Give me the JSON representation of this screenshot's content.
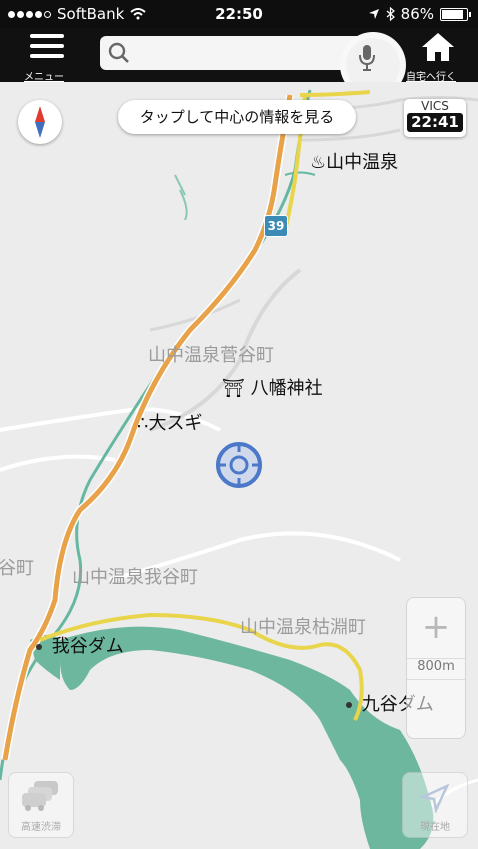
{
  "status_bar": {
    "carrier": "SoftBank",
    "time": "22:50",
    "battery": "86%",
    "battery_level": 0.86
  },
  "top_bar": {
    "menu_label": "メニュー",
    "search_placeholder": "",
    "home_label": "自宅へ行く"
  },
  "map_controls": {
    "center_tip": "タップして中心の情報を見る",
    "vics_name": "VICS",
    "vics_time": "22:41",
    "scale": "800m",
    "traffic_label": "高速渋滞",
    "current_location_label": "現在地"
  },
  "map": {
    "route_number": "39",
    "pois": {
      "onsen": "山中温泉",
      "shrine": "八幡神社",
      "cedar": "大スギ",
      "dam_a": "我谷ダム",
      "dam_b": "九谷ダム"
    },
    "areas": {
      "sugatani": "山中温泉菅谷町",
      "wagatani": "山中温泉我谷町",
      "kabuchi": "山中温泉枯淵町",
      "left_edge": "谷町"
    }
  },
  "colors": {
    "map_background": "#ececec",
    "road_orange": "#e8a24a",
    "road_yellow": "#e8d54c",
    "river_teal": "#66b7a2",
    "water_fill": "#6db79f",
    "location_blue": "#4b78c8"
  }
}
